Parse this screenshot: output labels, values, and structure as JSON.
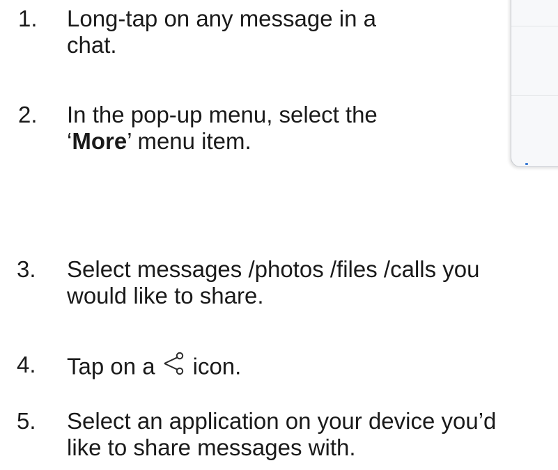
{
  "steps": [
    {
      "number": "1.",
      "lines": [
        "Long-tap on any message in a",
        "chat."
      ]
    },
    {
      "number": "2.",
      "line1": "In the pop-up menu, select the",
      "line2_open": "‘",
      "line2_bold": "More",
      "line2_rest": "’ menu item."
    },
    {
      "number": "3.",
      "lines": [
        "Select messages /photos /files /calls you",
        "would like to share."
      ]
    },
    {
      "number": "4.",
      "before_icon": "Tap on a",
      "icon": "share-icon",
      "after_icon": "icon."
    },
    {
      "number": "5.",
      "lines": [
        "Select an application on your device you’d",
        "like to share messages with."
      ]
    }
  ]
}
